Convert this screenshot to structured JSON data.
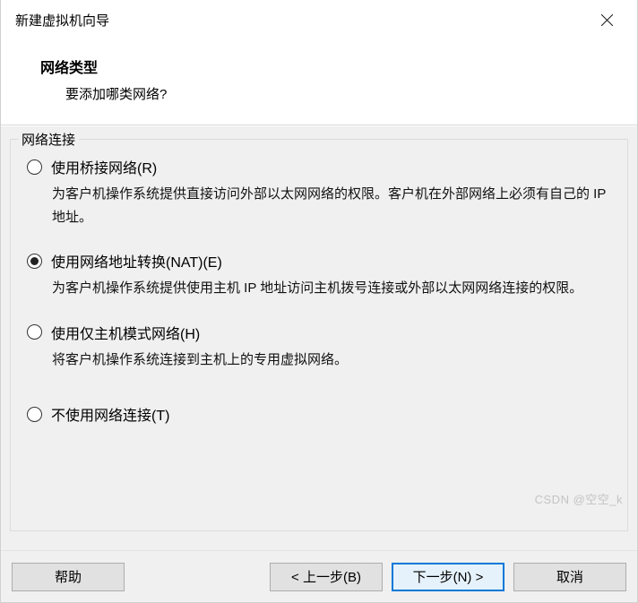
{
  "titlebar": {
    "title": "新建虚拟机向导"
  },
  "header": {
    "title": "网络类型",
    "subtitle": "要添加哪类网络?"
  },
  "fieldset": {
    "legend": "网络连接",
    "options": [
      {
        "label": "使用桥接网络(R)",
        "desc": "为客户机操作系统提供直接访问外部以太网网络的权限。客户机在外部网络上必须有自己的 IP 地址。",
        "checked": false
      },
      {
        "label": "使用网络地址转换(NAT)(E)",
        "desc": "为客户机操作系统提供使用主机 IP 地址访问主机拨号连接或外部以太网网络连接的权限。",
        "checked": true
      },
      {
        "label": "使用仅主机模式网络(H)",
        "desc": "将客户机操作系统连接到主机上的专用虚拟网络。",
        "checked": false
      },
      {
        "label": "不使用网络连接(T)",
        "desc": "",
        "checked": false
      }
    ]
  },
  "footer": {
    "help": "帮助",
    "back": "< 上一步(B)",
    "next": "下一步(N) >",
    "cancel": "取消"
  },
  "watermark": "CSDN @空空_k"
}
